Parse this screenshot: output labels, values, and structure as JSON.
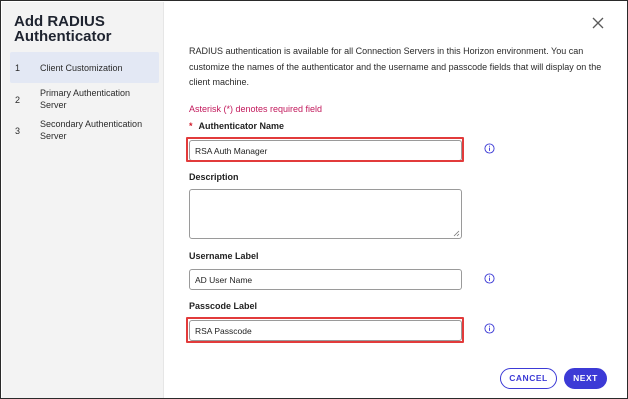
{
  "dialog": {
    "title": "Add RADIUS Authenticator",
    "close_icon": "close-icon"
  },
  "sidebar": {
    "steps": [
      {
        "number": "1",
        "label": "Client Customization",
        "active": true
      },
      {
        "number": "2",
        "label": "Primary Authentication Server",
        "active": false
      },
      {
        "number": "3",
        "label": "Secondary Authentication Server",
        "active": false
      }
    ]
  },
  "main": {
    "intro": "RADIUS authentication is available for all Connection Servers in this Horizon environment. You can customize the names of the authenticator and the username and passcode fields that will display on the client machine.",
    "required_note": "Asterisk (*) denotes required field",
    "fields": {
      "authenticator_name": {
        "label": "Authenticator Name",
        "required": "*",
        "value": "RSA Auth Manager",
        "info_icon": "info-icon"
      },
      "description": {
        "label": "Description",
        "value": ""
      },
      "username_label": {
        "label": "Username Label",
        "value": "AD User Name",
        "info_icon": "info-icon"
      },
      "passcode_label": {
        "label": "Passcode Label",
        "value": "RSA Passcode",
        "info_icon": "info-icon"
      }
    }
  },
  "footer": {
    "cancel_label": "CANCEL",
    "next_label": "NEXT"
  },
  "colors": {
    "accent": "#3c3ad6",
    "highlight": "#e23b3b",
    "required": "#c2185b",
    "sidebar_bg": "#f3f3f3",
    "active_step_bg": "#e3e8f4"
  }
}
